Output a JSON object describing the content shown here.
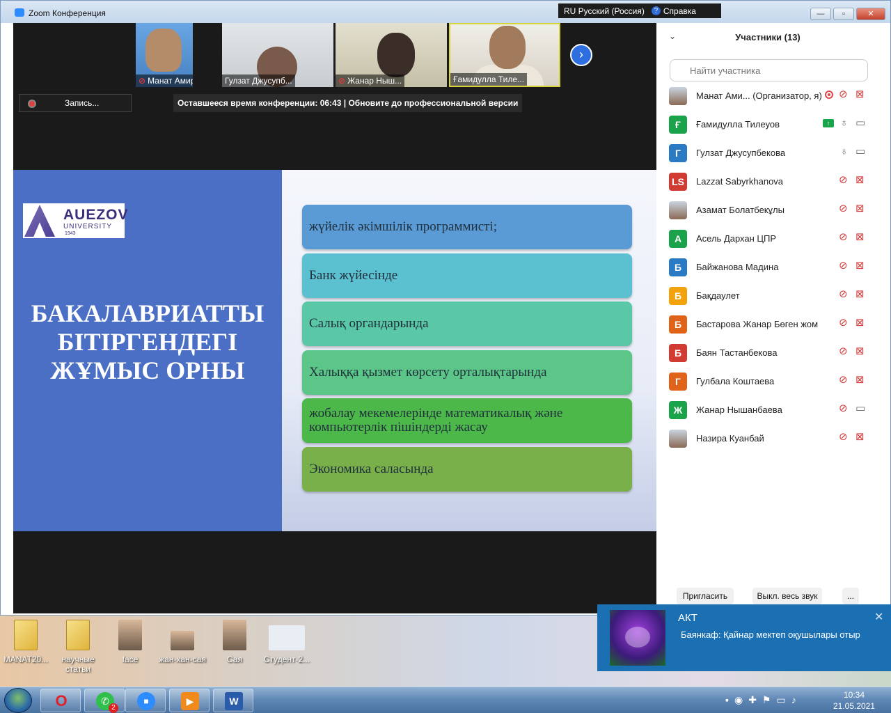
{
  "window": {
    "title": "Zoom Конференция",
    "lang": "RU Русский (Россия)",
    "help": "Справка",
    "minimize": "—",
    "maximize": "▫",
    "close": "✕"
  },
  "video_strip": {
    "tiles": [
      {
        "name": "Манат Амир...",
        "muted": true
      },
      {
        "name": "Гулзат Джусупб...",
        "muted": false
      },
      {
        "name": "Жанар Ныш...",
        "muted": true
      },
      {
        "name": "Ғамидулла Тиле...",
        "muted": false
      }
    ],
    "record_label": "Запись...",
    "time_notice": "Оставшееся время конференции: 06:43 | Обновите до профессиональной версии"
  },
  "slide": {
    "logo_big": "AUEZOV",
    "logo_small": "UNIVERSITY",
    "logo_year": "1943",
    "title_lines": [
      "БАКАЛАВРИАТТЫ",
      "БІТІРГЕНДЕГІ",
      "ЖҰМЫС ОРНЫ"
    ],
    "items": [
      "жүйелік әкімшілік программисті;",
      "Банк жүйесінде",
      "Салық органдарында",
      "Халыққа қызмет көрсету орталықтарында",
      "жобалау мекемелерінде математикалық және компьютерлік пішіндерді жасау",
      "Экономика саласында"
    ],
    "item_colors": [
      "#5b9bd5",
      "#5bc0cf",
      "#5ac8a7",
      "#5cc588",
      "#4cb84a",
      "#79b04a"
    ]
  },
  "participants": {
    "title": "Участники (13)",
    "search_placeholder": "Найти участника",
    "list": [
      {
        "name": "Манат Ами... (Организатор, я)",
        "avatar": "",
        "color": "",
        "mic": "muted",
        "cam": "off",
        "extra": "rec"
      },
      {
        "name": "Ғамидулла Тилеуов",
        "avatar": "Ғ",
        "color": "#1aa34a",
        "mic": "on",
        "cam": "on",
        "extra": "share"
      },
      {
        "name": "Гулзат Джусупбекова",
        "avatar": "Г",
        "color": "#2b7bc4",
        "mic": "on",
        "cam": "on",
        "extra": ""
      },
      {
        "name": "Lazzat Sabyrkhanova",
        "avatar": "LS",
        "color": "#d23b32",
        "mic": "muted",
        "cam": "off",
        "extra": ""
      },
      {
        "name": "Азамат Болатбекұлы",
        "avatar": "",
        "color": "",
        "mic": "muted",
        "cam": "off",
        "extra": ""
      },
      {
        "name": "Асель Дархан  ЦПР",
        "avatar": "А",
        "color": "#1aa34a",
        "mic": "muted",
        "cam": "off",
        "extra": ""
      },
      {
        "name": "Байжанова Мадина",
        "avatar": "Б",
        "color": "#2b7bc4",
        "mic": "muted",
        "cam": "off",
        "extra": ""
      },
      {
        "name": "Бақдаулет",
        "avatar": "Б",
        "color": "#f2a20c",
        "mic": "muted",
        "cam": "off",
        "extra": ""
      },
      {
        "name": "Бастарова Жанар Бөген жом",
        "avatar": "Б",
        "color": "#e0631a",
        "mic": "muted",
        "cam": "off",
        "extra": ""
      },
      {
        "name": "Баян Тастанбекова",
        "avatar": "Б",
        "color": "#d23b32",
        "mic": "muted",
        "cam": "off",
        "extra": ""
      },
      {
        "name": "Гулбала Коштаева",
        "avatar": "Г",
        "color": "#e0631a",
        "mic": "muted",
        "cam": "off",
        "extra": ""
      },
      {
        "name": "Жанар Нышанбаева",
        "avatar": "Ж",
        "color": "#1aa34a",
        "mic": "muted",
        "cam": "on",
        "extra": ""
      },
      {
        "name": "Назира Куанбай",
        "avatar": "",
        "color": "",
        "mic": "muted",
        "cam": "off",
        "extra": ""
      }
    ],
    "invite": "Пригласить",
    "mute_all": "Выкл. весь звук",
    "more": "..."
  },
  "desktop": {
    "icons": [
      "MANAT20...",
      "научные статьи",
      "face",
      "жан-хан-сая",
      "Сая",
      "Студент-2..."
    ]
  },
  "notification": {
    "title": "АКТ",
    "body": "Баянкаф: Қайнар мектеп оқушылары отыр",
    "close": "✕"
  },
  "taskbar": {
    "whatsapp_badge": "2",
    "time": "10:34",
    "date": "21.05.2021"
  }
}
